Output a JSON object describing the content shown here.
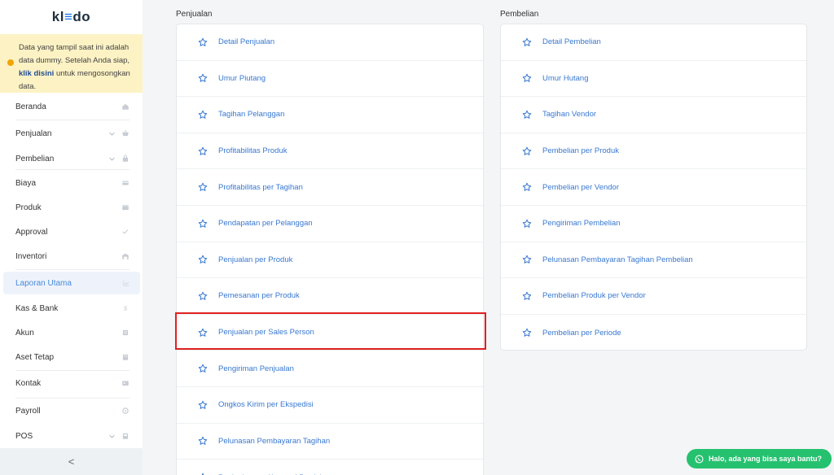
{
  "sidebar": {
    "logo_prefix": "kl",
    "logo_accent": "≡",
    "logo_suffix": "do",
    "notice": {
      "text_before": "Data yang tampil saat ini adalah data dummy. Setelah Anda siap,",
      "link": "klik disini",
      "text_after": "untuk mengosongkan data."
    },
    "items": [
      {
        "label": "Beranda",
        "icon": "home-icon",
        "chevron": false
      },
      {
        "label": "Penjualan",
        "icon": "basket-icon",
        "chevron": true
      },
      {
        "label": "Pembelian",
        "icon": "bag-icon",
        "chevron": true
      },
      {
        "label": "Biaya",
        "icon": "card-icon",
        "chevron": false
      },
      {
        "label": "Produk",
        "icon": "box-icon",
        "chevron": false
      },
      {
        "label": "Approval",
        "icon": "check-icon",
        "chevron": false
      },
      {
        "label": "Inventori",
        "icon": "warehouse-icon",
        "chevron": false
      },
      {
        "label": "Laporan Utama",
        "icon": "chart-icon",
        "chevron": false,
        "active": true
      },
      {
        "label": "Kas & Bank",
        "icon": "dollar-icon",
        "chevron": false
      },
      {
        "label": "Akun",
        "icon": "ledger-icon",
        "chevron": false
      },
      {
        "label": "Aset Tetap",
        "icon": "building-icon",
        "chevron": false
      },
      {
        "label": "Kontak",
        "icon": "contact-card-icon",
        "chevron": false
      },
      {
        "label": "Payroll",
        "icon": "gear-icon",
        "chevron": false
      },
      {
        "label": "POS",
        "icon": "pos-icon",
        "chevron": true
      }
    ],
    "collapse_label": "<"
  },
  "penjualan": {
    "title": "Penjualan",
    "items": [
      "Detail Penjualan",
      "Umur Piutang",
      "Tagihan Pelanggan",
      "Profitabilitas Produk",
      "Profitabilitas per Tagihan",
      "Pendapatan per Pelanggan",
      "Penjualan per Produk",
      "Pemesanan per Produk",
      "Penjualan per Sales Person",
      "Pengiriman Penjualan",
      "Ongkos Kirim per Ekspedisi",
      "Pelunasan Pembayaran Tagihan",
      "Penjualan per Kategori Produk"
    ]
  },
  "pembelian": {
    "title": "Pembelian",
    "items": [
      "Detail Pembelian",
      "Umur Hutang",
      "Tagihan Vendor",
      "Pembelian per Produk",
      "Pembelian per Vendor",
      "Pengiriman Pembelian",
      "Pelunasan Pembayaran Tagihan Pembelian",
      "Pembelian Produk per Vendor",
      "Pembelian per Periode"
    ]
  },
  "chat": {
    "label": "Halo, ada yang bisa saya bantu?"
  },
  "colors": {
    "accent": "#3878d0",
    "highlight": "#e02020",
    "chat": "#25c16f",
    "notice": "#fdf2c4"
  }
}
